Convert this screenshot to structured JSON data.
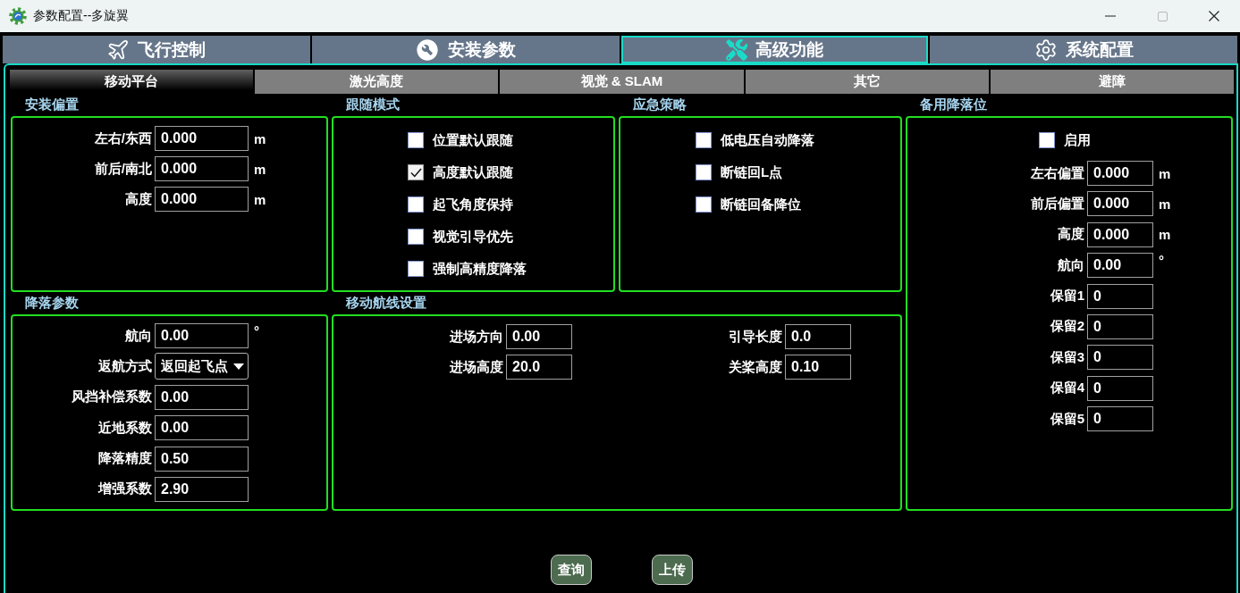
{
  "window": {
    "title": "参数配置--多旋翼",
    "controls": [
      {
        "kind": "minimize",
        "disabled": false
      },
      {
        "kind": "maximize",
        "disabled": true
      },
      {
        "kind": "close",
        "disabled": false
      }
    ]
  },
  "main_tabs": [
    {
      "label": "飞行控制",
      "selected": false
    },
    {
      "label": "安装参数",
      "selected": false
    },
    {
      "label": "高级功能",
      "selected": true
    },
    {
      "label": "系统配置",
      "selected": false
    }
  ],
  "sub_tabs": [
    {
      "label": "移动平台",
      "selected": true
    },
    {
      "label": "激光高度",
      "selected": false
    },
    {
      "label": "视觉 & SLAM",
      "selected": false
    },
    {
      "label": "其它",
      "selected": false
    },
    {
      "label": "避障",
      "selected": false
    }
  ],
  "mounting_offset": {
    "title": "安装偏置",
    "fields": [
      {
        "label": "左右/东西",
        "value": "0.000",
        "unit": "m"
      },
      {
        "label": "前后/南北",
        "value": "0.000",
        "unit": "m"
      },
      {
        "label": "高度",
        "value": "0.000",
        "unit": "m"
      }
    ]
  },
  "follow_mode": {
    "title": "跟随模式",
    "options": [
      {
        "label": "位置默认跟随",
        "checked": false
      },
      {
        "label": "高度默认跟随",
        "checked": true
      },
      {
        "label": "起飞角度保持",
        "checked": false
      },
      {
        "label": "视觉引导优先",
        "checked": false
      },
      {
        "label": "强制高精度降落",
        "checked": false
      }
    ]
  },
  "emergency_strategy": {
    "title": "应急策略",
    "options": [
      {
        "label": "低电压自动降落",
        "checked": false
      },
      {
        "label": "断链回L点",
        "checked": false
      },
      {
        "label": "断链回备降位",
        "checked": false
      }
    ]
  },
  "backup_landing": {
    "title": "备用降落位",
    "enable": {
      "label": "启用",
      "checked": false
    },
    "fields": [
      {
        "label": "左右偏置",
        "value": "0.000",
        "unit": "m"
      },
      {
        "label": "前后偏置",
        "value": "0.000",
        "unit": "m"
      },
      {
        "label": "高度",
        "value": "0.000",
        "unit": "m"
      },
      {
        "label": "航向",
        "value": "0.00",
        "unit": "°"
      },
      {
        "label": "保留1",
        "value": "0"
      },
      {
        "label": "保留2",
        "value": "0"
      },
      {
        "label": "保留3",
        "value": "0"
      },
      {
        "label": "保留4",
        "value": "0"
      },
      {
        "label": "保留5",
        "value": "0"
      }
    ]
  },
  "landing_params": {
    "title": "降落参数",
    "fields": [
      {
        "kind": "input",
        "label": "航向",
        "value": "0.00",
        "unit": "°"
      },
      {
        "kind": "select",
        "label": "返航方式",
        "value": "返回起飞点"
      },
      {
        "kind": "input",
        "label": "风挡补偿系数",
        "value": "0.00"
      },
      {
        "kind": "input",
        "label": "近地系数",
        "value": "0.00"
      },
      {
        "kind": "input",
        "label": "降落精度",
        "value": "0.50"
      },
      {
        "kind": "input",
        "label": "增强系数",
        "value": "2.90"
      }
    ]
  },
  "moving_route": {
    "title": "移动航线设置",
    "fields": [
      {
        "label": "进场方向",
        "value": "0.00"
      },
      {
        "label": "引导长度",
        "value": "0.0"
      },
      {
        "label": "进场高度",
        "value": "20.0"
      },
      {
        "label": "关桨高度",
        "value": "0.10"
      }
    ]
  },
  "buttons": [
    {
      "label": "查询"
    },
    {
      "label": "上传"
    }
  ]
}
